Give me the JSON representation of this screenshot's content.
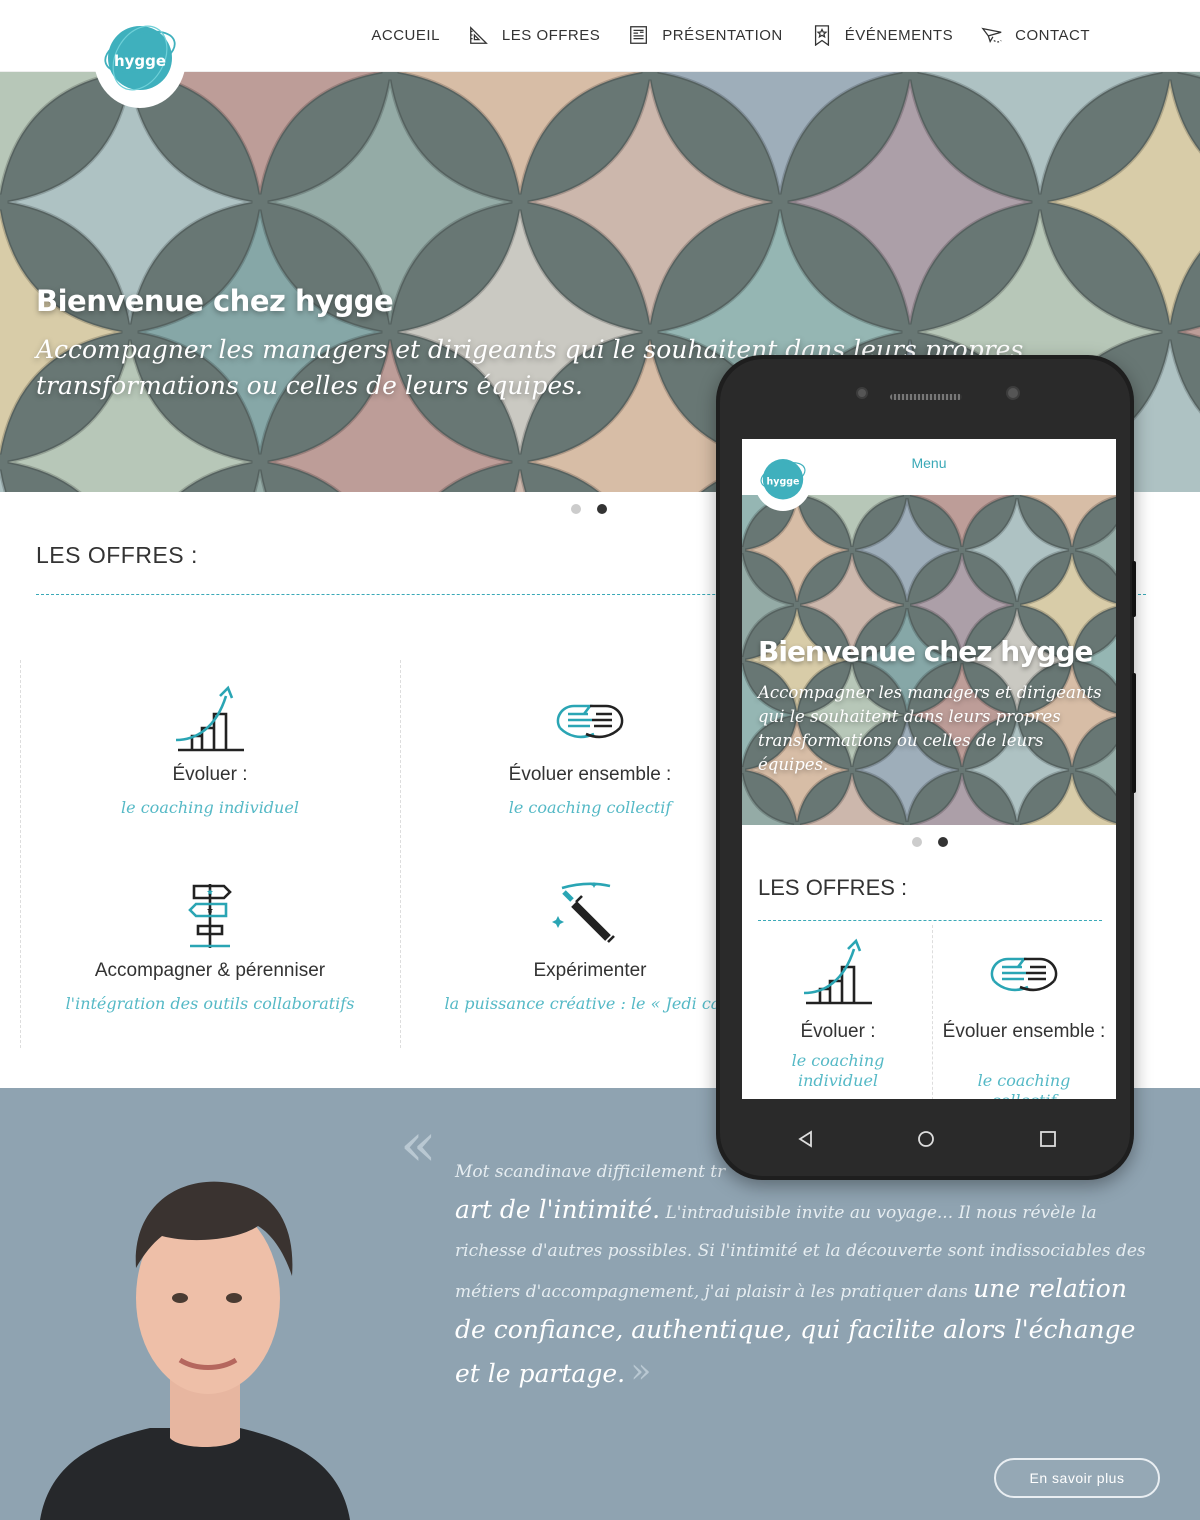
{
  "header": {
    "logo_text": "hygge",
    "nav": [
      {
        "label": "ACCUEIL",
        "icon": ""
      },
      {
        "label": "LES OFFRES",
        "icon": "ruler-triangle-icon"
      },
      {
        "label": "PRÉSENTATION",
        "icon": "newspaper-icon"
      },
      {
        "label": "ÉVÉNEMENTS",
        "icon": "bookmark-star-icon"
      },
      {
        "label": "CONTACT",
        "icon": "paper-plane-icon"
      }
    ]
  },
  "hero": {
    "title": "Bienvenue chez hygge",
    "subtitle": "Accompagner les managers et dirigeants qui le souhaitent dans leurs propres transformations ou celles de leurs équipes."
  },
  "offres": {
    "title": "LES OFFRES :",
    "items": [
      {
        "name": "Évoluer :",
        "desc": "le coaching individuel",
        "icon": "growth-chart-icon"
      },
      {
        "name": "Évoluer ensemble :",
        "desc": "le coaching collectif",
        "icon": "handshake-icon"
      },
      {
        "name": "Accompagner & pérenniser",
        "desc": "l'intégration des outils collaboratifs",
        "icon": "signpost-icon"
      },
      {
        "name": "Expérimenter",
        "desc": "la puissance créative : le « Jedi cam",
        "icon": "lightsaber-icon"
      }
    ]
  },
  "about": {
    "quote_open": "«",
    "quote_p1": "Mot scandinave difficilement tr",
    "quote_p1b": "et",
    "quote_p2_big": "art de l'intimité.",
    "quote_p2": " L'intraduisible invite au voyage... Il nous révèle la richesse d'autres possibles. Si l'intimité et la découverte sont indissociables des métiers d'accompagnement, j'ai plaisir à les pratiquer dans ",
    "quote_p3_big": "une relation de confiance, authentique, qui facilite alors l'échange et le partage.",
    "quote_close": "»",
    "button": "En savoir plus"
  },
  "mobile": {
    "menu": "Menu",
    "title": "Bienvenue chez hygge",
    "subtitle": "Accompagner les managers et dirigeants qui le souhaitent dans leurs propres transformations ou celles de leurs équipes.",
    "offres_title": "LES OFFRES :",
    "items": [
      {
        "name": "Évoluer :",
        "desc": "le coaching individuel"
      },
      {
        "name": "Évoluer ensemble :",
        "desc": "le coaching collectif"
      }
    ]
  },
  "colors": {
    "accent": "#3aa9b7",
    "accent_light": "#55b9c6",
    "band": "#8fa3b1"
  }
}
